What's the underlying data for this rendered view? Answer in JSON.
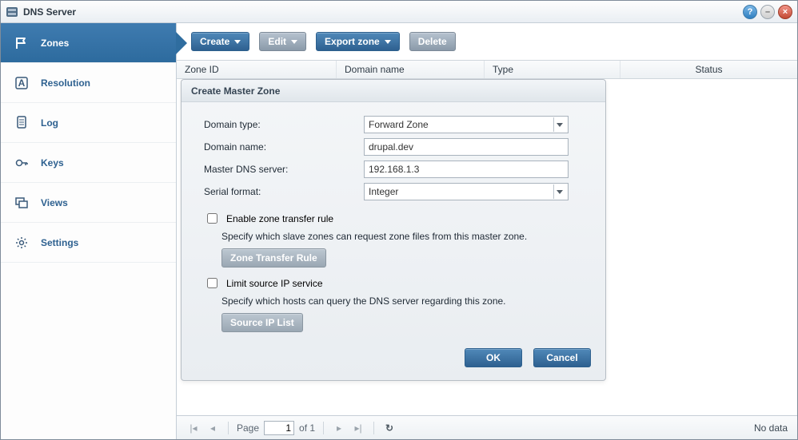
{
  "window": {
    "title": "DNS Server"
  },
  "sidebar": {
    "items": [
      {
        "label": "Zones"
      },
      {
        "label": "Resolution"
      },
      {
        "label": "Log"
      },
      {
        "label": "Keys"
      },
      {
        "label": "Views"
      },
      {
        "label": "Settings"
      }
    ]
  },
  "toolbar": {
    "create": "Create",
    "edit": "Edit",
    "export": "Export zone",
    "delete": "Delete"
  },
  "grid": {
    "columns": {
      "zone_id": "Zone ID",
      "domain_name": "Domain name",
      "type": "Type",
      "status": "Status"
    }
  },
  "dialog": {
    "title": "Create Master Zone",
    "labels": {
      "domain_type": "Domain type:",
      "domain_name": "Domain name:",
      "master_dns": "Master DNS server:",
      "serial_format": "Serial format:"
    },
    "values": {
      "domain_type": "Forward Zone",
      "domain_name": "drupal.dev",
      "master_dns": "192.168.1.3",
      "serial_format": "Integer"
    },
    "checkboxes": {
      "enable_transfer": "Enable zone transfer rule",
      "transfer_desc": "Specify which slave zones can request zone files from this master zone.",
      "transfer_btn": "Zone Transfer Rule",
      "limit_source": "Limit source IP service",
      "limit_desc": "Specify which hosts can query the DNS server regarding this zone.",
      "limit_btn": "Source IP List"
    },
    "buttons": {
      "ok": "OK",
      "cancel": "Cancel"
    }
  },
  "statusbar": {
    "page_label": "Page",
    "page_value": "1",
    "of_label": "of 1",
    "no_data": "No data"
  }
}
